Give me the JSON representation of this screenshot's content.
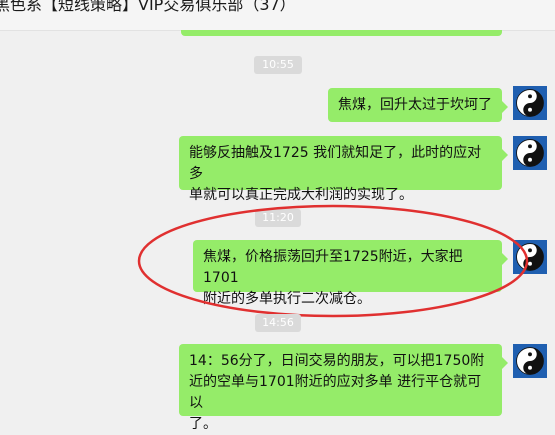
{
  "window": {
    "title": "黑色系【短线策略】VIP交易俱乐部（37）"
  },
  "chat": {
    "messages": [
      {
        "type": "bubble",
        "text": "",
        "side": "right"
      },
      {
        "type": "time",
        "text": "10:55"
      },
      {
        "type": "bubble",
        "text": "焦煤，回升太过于坎坷了",
        "side": "right"
      },
      {
        "type": "bubble",
        "text": "能够反抽触及1725 我们就知足了，此时的应对多单就可以真正完成大利润的实现了。",
        "side": "right"
      },
      {
        "type": "time",
        "text": "11:20"
      },
      {
        "type": "bubble",
        "text": "焦煤，价格振荡回升至1725附近，大家把1701附近的多单执行二次减仓。",
        "side": "right",
        "highlighted": true
      },
      {
        "type": "time",
        "text": "14:56"
      },
      {
        "type": "bubble",
        "text": "14：56分了，日间交易的朋友，可以把1750附近的空单与1701附近的应对多单 进行平仓就可以了。",
        "side": "right"
      }
    ],
    "lines": {
      "m2": [
        "焦煤，回升太过于坎坷了"
      ],
      "m3": [
        "能够反抽触及1725 我们就知足了，此时的应对多",
        "单就可以真正完成大利润的实现了。"
      ],
      "m4": [
        "焦煤，价格振荡回升至1725附近，大家把1701",
        "附近的多单执行二次减仓。"
      ],
      "m5": [
        "14：56分了，日间交易的朋友，可以把1750附",
        "近的空单与1701附近的应对多单 进行平仓就可以",
        "了。"
      ]
    },
    "avatar_icon": "yin-yang-icon",
    "bubble_color": "#95ec69",
    "highlight_color": "#e03030"
  }
}
